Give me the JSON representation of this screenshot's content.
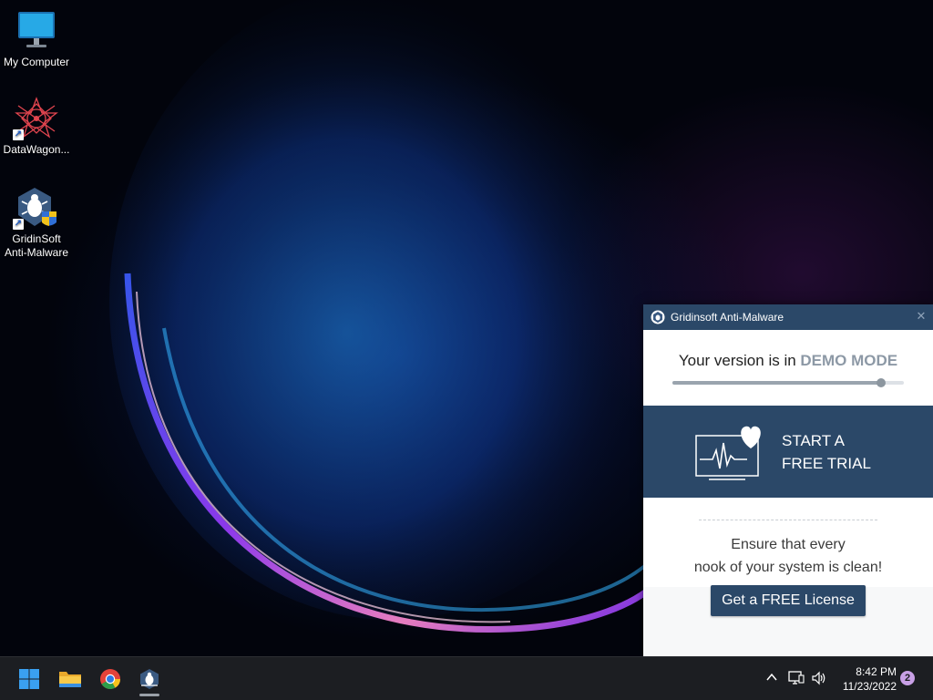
{
  "desktop": {
    "icons": [
      {
        "label": "My Computer",
        "icon": "monitor-icon"
      },
      {
        "label": "DataWagon...",
        "icon": "datawagon-icon",
        "shortcut": true
      },
      {
        "label": "GridinSoft Anti-Malware",
        "icon": "gridinsoft-icon",
        "shortcut": true
      }
    ]
  },
  "popup": {
    "title": "Gridinsoft Anti-Malware",
    "demo_prefix": "Your version is in",
    "demo_mode": "DEMO MODE",
    "demo_progress": 0.9,
    "trial_line1": "START A",
    "trial_line2": "FREE TRIAL",
    "tagline_line1": "Ensure that every",
    "tagline_line2": "nook of your system is clean!",
    "cta_label": "Get a FREE License",
    "accent_color": "#2b4868"
  },
  "taskbar": {
    "apps": [
      "windows-start-icon",
      "file-explorer-icon",
      "chrome-icon",
      "gridinsoft-taskbar-icon"
    ],
    "time": "8:42 PM",
    "date": "11/23/2022",
    "notification_count": "2"
  }
}
